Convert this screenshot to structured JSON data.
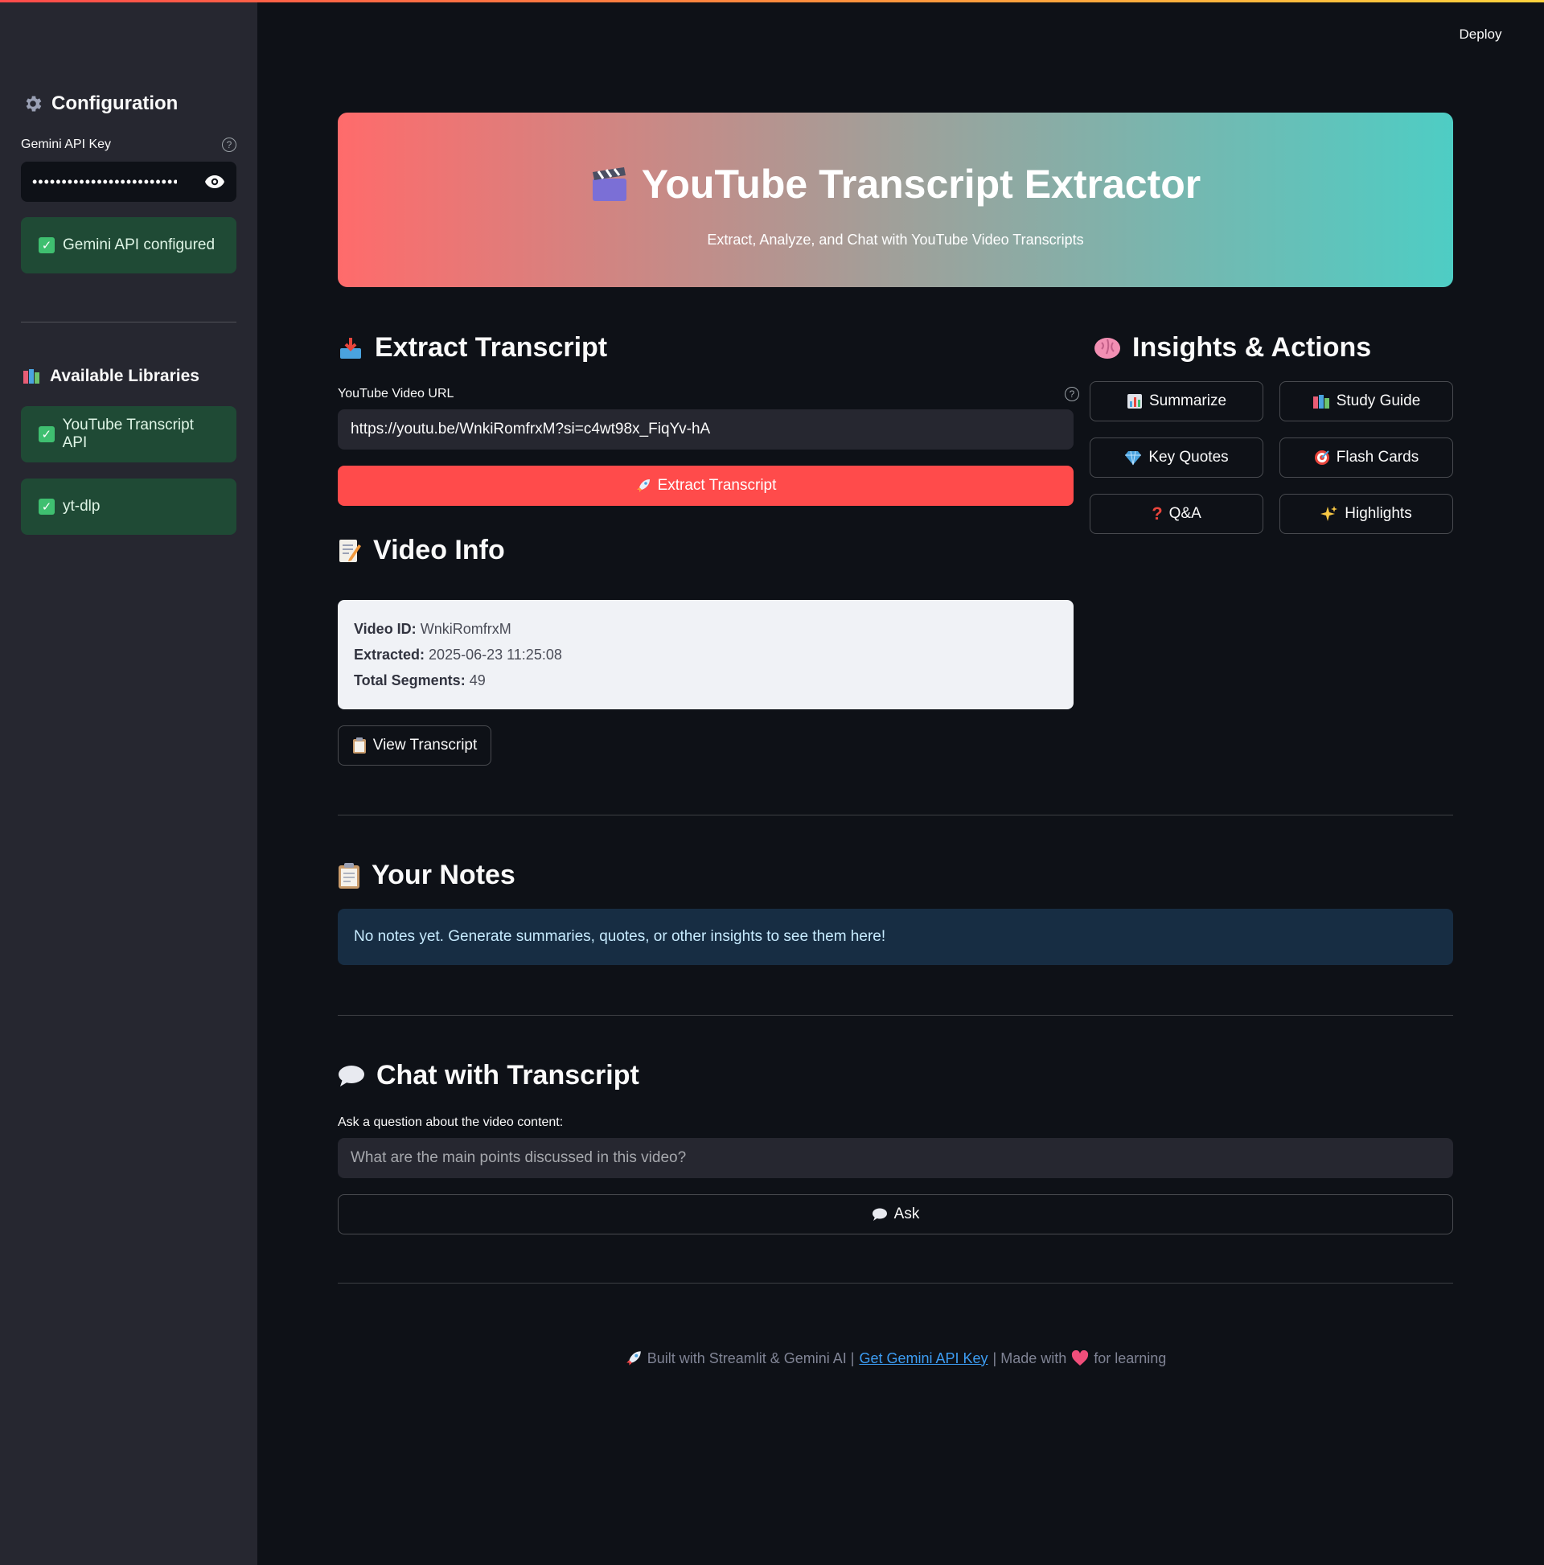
{
  "header": {
    "deploy_label": "Deploy"
  },
  "sidebar": {
    "title": "Configuration",
    "api_key_label": "Gemini API Key",
    "api_key_value": "••••••••••••••••••••••••••••••",
    "api_status": "Gemini API configured",
    "libraries_title": "Available Libraries",
    "libraries": [
      "YouTube Transcript API",
      "yt-dlp"
    ]
  },
  "banner": {
    "title": "YouTube Transcript Extractor",
    "subtitle": "Extract, Analyze, and Chat with YouTube Video Transcripts"
  },
  "extract": {
    "title": "Extract Transcript",
    "url_label": "YouTube Video URL",
    "url_value": "https://youtu.be/WnkiRomfrxM?si=c4wt98x_FiqYv-hA",
    "button_label": "Extract Transcript"
  },
  "insights": {
    "title": "Insights & Actions",
    "buttons": [
      "Summarize",
      "Study Guide",
      "Key Quotes",
      "Flash Cards",
      "Q&A",
      "Highlights"
    ]
  },
  "video_info": {
    "title": "Video Info",
    "id_label": "Video ID:",
    "id_value": "WnkiRomfrxM",
    "extracted_label": "Extracted:",
    "extracted_value": "2025-06-23 11:25:08",
    "segments_label": "Total Segments:",
    "segments_value": "49",
    "view_button": "View Transcript"
  },
  "notes": {
    "title": "Your Notes",
    "empty_message": "No notes yet. Generate summaries, quotes, or other insights to see them here!"
  },
  "chat": {
    "title": "Chat with Transcript",
    "question_label": "Ask a question about the video content:",
    "question_placeholder": "What are the main points discussed in this video?",
    "ask_button": "Ask"
  },
  "footer": {
    "built_text": "Built with Streamlit & Gemini AI |",
    "link_text": "Get Gemini API Key",
    "made_text": "| Made with",
    "end_text": "for learning"
  },
  "colors": {
    "background": "#0e1117",
    "sidebar": "#262730",
    "primary": "#ff4b4b",
    "success_bg": "#1f4a35",
    "info_bg": "#172d43",
    "link": "#3d9df3"
  }
}
